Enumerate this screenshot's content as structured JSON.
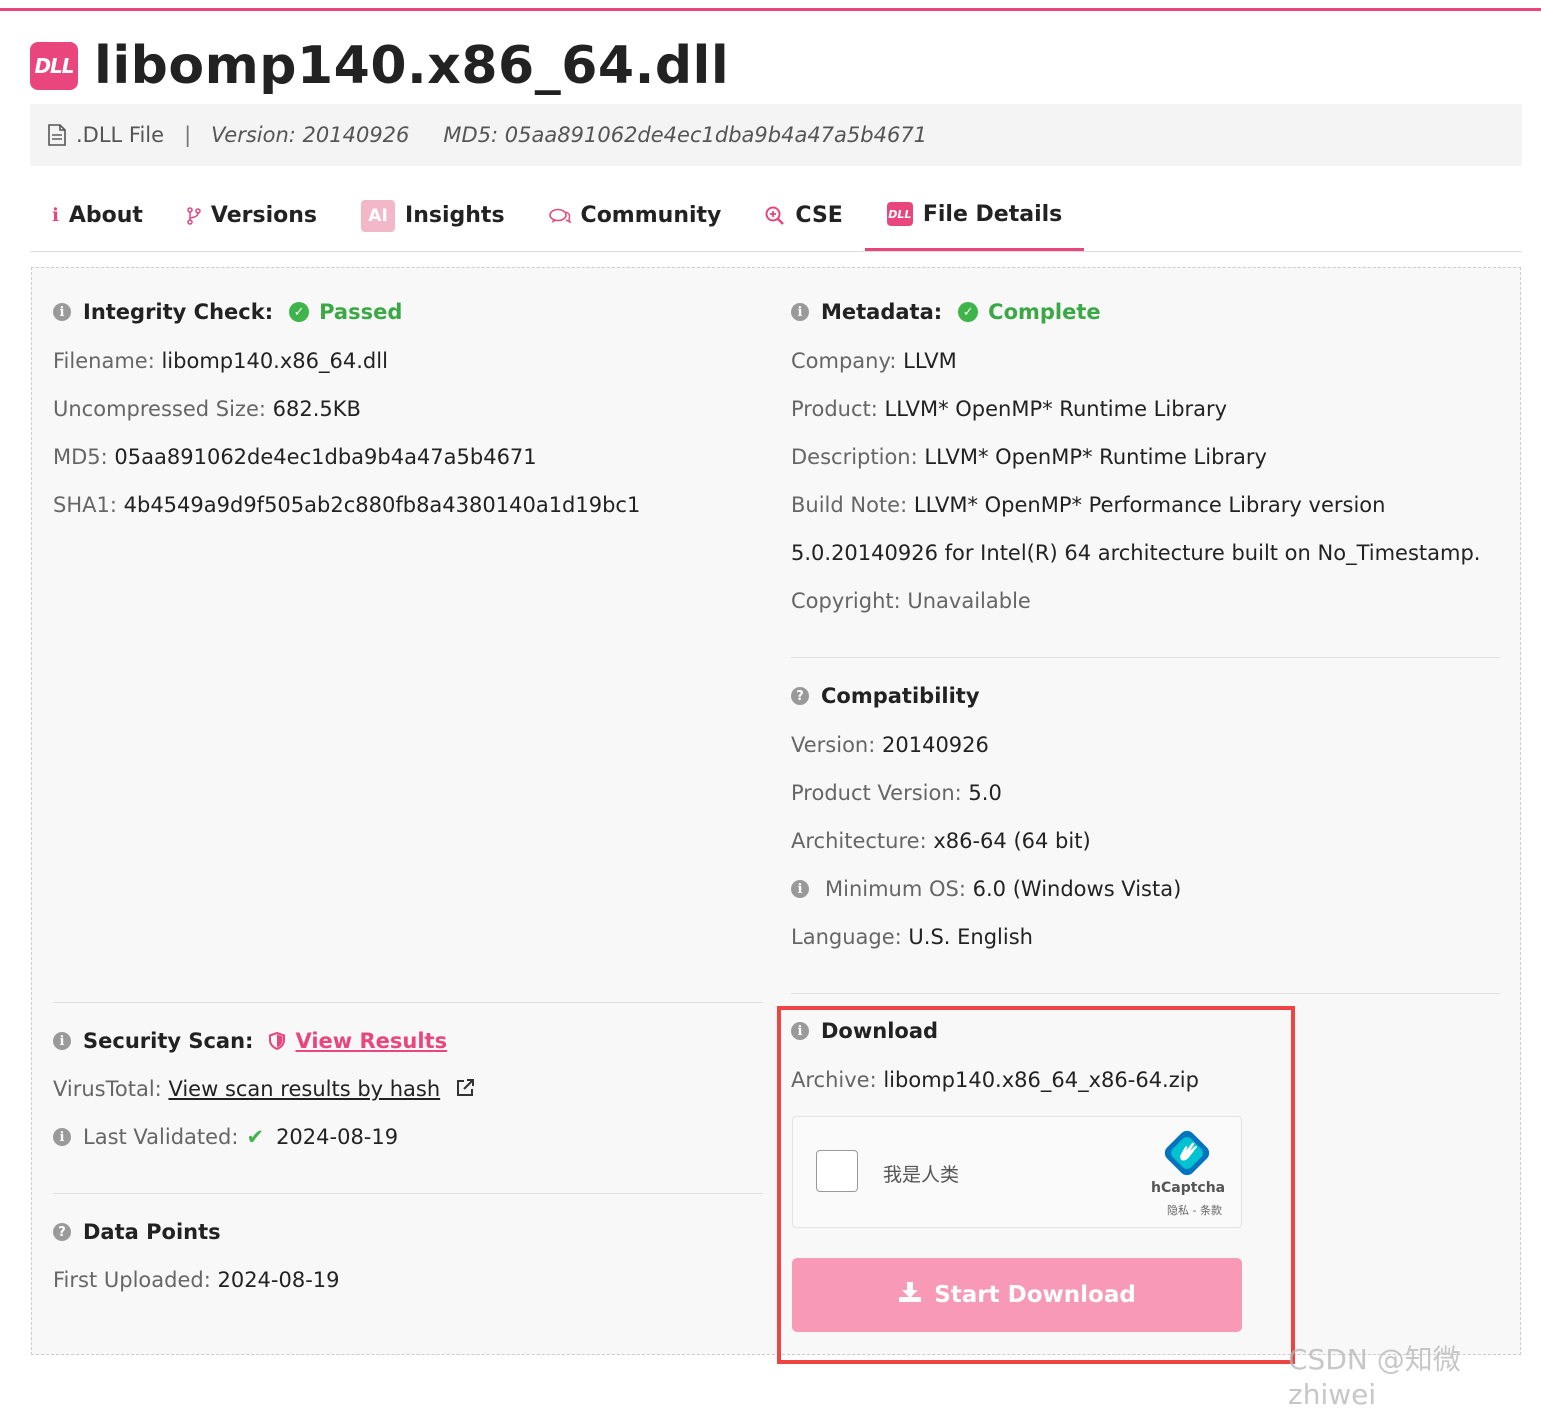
{
  "header": {
    "badge": "DLL",
    "title": "libomp140.x86_64.dll",
    "file_type": ".DLL File",
    "separator": "|",
    "version": "Version: 20140926",
    "md5": "MD5: 05aa891062de4ec1dba9b4a47a5b4671"
  },
  "tabs": [
    {
      "label": "About",
      "icon": "info-icon"
    },
    {
      "label": "Versions",
      "icon": "branch-icon"
    },
    {
      "label": "Insights",
      "icon": "ai-icon",
      "icon_text": "AI"
    },
    {
      "label": "Community",
      "icon": "chat-icon"
    },
    {
      "label": "CSE",
      "icon": "search-icon"
    },
    {
      "label": "File Details",
      "icon": "dll-icon",
      "icon_text": "DLL",
      "active": true
    }
  ],
  "integrity": {
    "label": "Integrity Check:",
    "status": "Passed",
    "rows": [
      {
        "label": "Filename:",
        "value": "libomp140.x86_64.dll"
      },
      {
        "label": "Uncompressed Size:",
        "value": "682.5KB"
      },
      {
        "label": "MD5:",
        "value": "05aa891062de4ec1dba9b4a47a5b4671"
      },
      {
        "label": "SHA1:",
        "value": "4b4549a9d9f505ab2c880fb8a4380140a1d19bc1"
      }
    ]
  },
  "metadata": {
    "label": "Metadata:",
    "status": "Complete",
    "rows": [
      {
        "label": "Company:",
        "value": "LLVM"
      },
      {
        "label": "Product:",
        "value": "LLVM* OpenMP* Runtime Library"
      },
      {
        "label": "Description:",
        "value": "LLVM* OpenMP* Runtime Library"
      },
      {
        "label": "Build Note:",
        "value": "LLVM* OpenMP* Performance Library version"
      },
      {
        "label": "",
        "value": "5.0.20140926 for Intel(R) 64 architecture built on No_Timestamp."
      },
      {
        "label": "Copyright:",
        "value": "Unavailable"
      }
    ]
  },
  "compatibility": {
    "label": "Compatibility",
    "rows": [
      {
        "label": "Version:",
        "value": "20140926"
      },
      {
        "label": "Product Version:",
        "value": "5.0"
      },
      {
        "label": "Architecture:",
        "value": "x86-64 (64 bit)"
      },
      {
        "label": "Minimum OS:",
        "value": "6.0 (Windows Vista)"
      },
      {
        "label": "Language:",
        "value": "U.S. English"
      }
    ]
  },
  "security": {
    "label": "Security Scan:",
    "link": "View Results",
    "virustotal_label": "VirusTotal:",
    "virustotal_link": "View scan results by hash",
    "validated_label": "Last Validated:",
    "validated_value": "2024-08-19"
  },
  "datapoints": {
    "label": "Data Points",
    "first_uploaded_label": "First Uploaded:",
    "first_uploaded_value": "2024-08-19"
  },
  "download": {
    "label": "Download",
    "archive_label": "Archive:",
    "archive_value": "libomp140.x86_64_x86-64.zip",
    "captcha_text": "我是人类",
    "captcha_brand": "hCaptcha",
    "captcha_links": "隐私 - 条款",
    "button": "Start Download"
  },
  "watermark": "CSDN @知微zhiwei",
  "colors": {
    "accent": "#e8467c",
    "success": "#3aa845",
    "button": "#f999b8",
    "highlight": "#ef4444"
  }
}
